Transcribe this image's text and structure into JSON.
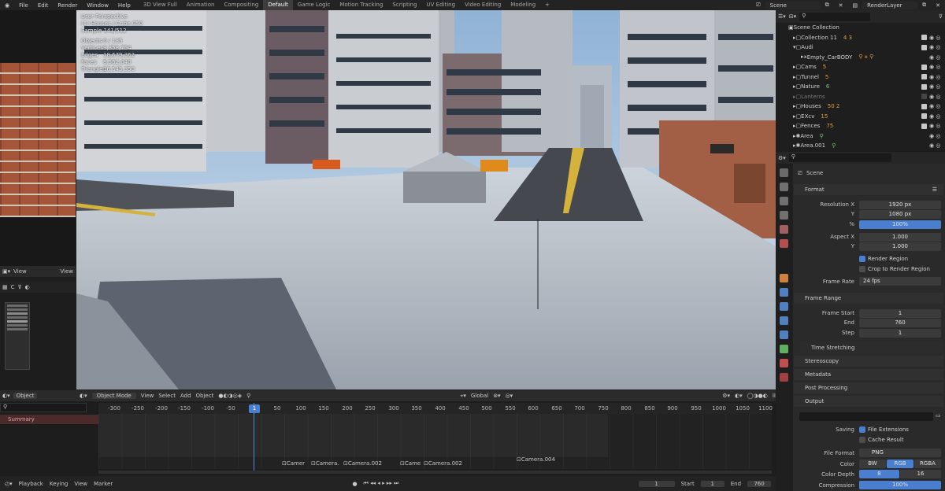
{
  "menu": [
    "File",
    "Edit",
    "Render",
    "Window",
    "Help"
  ],
  "workspaces": [
    "3D View Full",
    "Animation",
    "Compositing",
    "Default",
    "Game Logic",
    "Motion Tracking",
    "Scripting",
    "UV Editing",
    "Video Editing",
    "Modeling",
    "+"
  ],
  "active_workspace": "Default",
  "scene_name": "Scene",
  "render_layer": "RenderLayer",
  "viewport_stats": {
    "title": "User Perspective",
    "collection": "(1) Houses | Cube.050",
    "sample": "Sample 141/512",
    "rows": [
      {
        "label": "Objects",
        "value": "0 / 135"
      },
      {
        "label": "Vertices",
        "value": "9,358,754"
      },
      {
        "label": "Edges",
        "value": "18,679,362"
      },
      {
        "label": "Faces",
        "value": "8,562,040"
      },
      {
        "label": "Triangles",
        "value": "16,545,350"
      }
    ]
  },
  "left_panel": {
    "view_label": "View",
    "view2": "View",
    "c_label": "C"
  },
  "viewport_header": {
    "mode": "Object Mode",
    "items": [
      "View",
      "Select",
      "Add",
      "Object"
    ],
    "transform": "Global",
    "left_mode": "Object"
  },
  "timeline": {
    "ticks": [
      "-300",
      "-250",
      "-200",
      "-150",
      "-100",
      "-50",
      "1",
      "50",
      "100",
      "150",
      "200",
      "250",
      "300",
      "350",
      "400",
      "450",
      "500",
      "550",
      "600",
      "650",
      "700",
      "750",
      "800",
      "850",
      "900",
      "950",
      "1000",
      "1050",
      "1100"
    ],
    "summary_label": "Summary",
    "markers": [
      "Camer",
      "Camera.",
      "Camera.002",
      "Came",
      "Camera.002",
      "Camera.004"
    ],
    "current_frame": "1",
    "start_label": "Start",
    "start_value": "1",
    "end_label": "End",
    "end_value": "760",
    "play_menu": [
      "Playback",
      "Keying",
      "View",
      "Marker"
    ]
  },
  "outliner": {
    "root": "Scene Collection",
    "items": [
      {
        "name": "Collection 11",
        "badge": "4 3"
      },
      {
        "name": "Audi",
        "badge": ""
      },
      {
        "name": "Empty_CarBODY",
        "badge": ""
      },
      {
        "name": "Cams",
        "badge": "5"
      },
      {
        "name": "Tunnel",
        "badge": "5"
      },
      {
        "name": "Nature",
        "badge": "6"
      },
      {
        "name": "Lanterns",
        "badge": ""
      },
      {
        "name": "Houses",
        "badge": "50 2"
      },
      {
        "name": "EXcv",
        "badge": "15"
      },
      {
        "name": "Fences",
        "badge": "75"
      },
      {
        "name": "Area",
        "badge": ""
      },
      {
        "name": "Area.001",
        "badge": ""
      }
    ]
  },
  "properties": {
    "scene_label": "Scene",
    "format_section": "Format",
    "res_x_label": "Resolution X",
    "res_x": "1920 px",
    "res_y_label": "Y",
    "res_y": "1080 px",
    "pct_label": "%",
    "pct": "100%",
    "aspect_x_label": "Aspect X",
    "aspect_x": "1.000",
    "aspect_y_label": "Y",
    "aspect_y": "1.000",
    "render_region": "Render Region",
    "crop_region": "Crop to Render Region",
    "frame_rate_label": "Frame Rate",
    "frame_rate": "24 fps",
    "frame_range_section": "Frame Range",
    "frame_start_label": "Frame Start",
    "frame_start": "1",
    "end_label": "End",
    "end": "760",
    "step_label": "Step",
    "step": "1",
    "time_stretching": "Time Stretching",
    "stereoscopy": "Stereoscopy",
    "metadata": "Metadata",
    "post_processing": "Post Processing",
    "output_section": "Output",
    "saving_label": "Saving",
    "file_extensions": "File Extensions",
    "cache_result": "Cache Result",
    "file_format_label": "File Format",
    "file_format": "PNG",
    "color_label": "Color",
    "color_opts": [
      "BW",
      "RGB",
      "RGBA"
    ],
    "color_depth_label": "Color Depth",
    "depth_opts": [
      "8",
      "16"
    ],
    "compression_label": "Compression",
    "compression": "100%"
  }
}
